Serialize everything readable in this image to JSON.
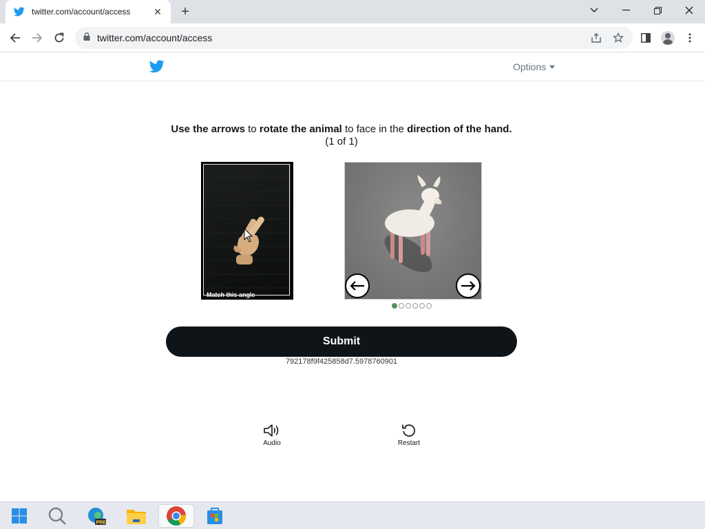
{
  "browser": {
    "tab": {
      "title": "twitter.com/account/access",
      "close": "✕"
    },
    "new_tab": "+",
    "url": "twitter.com/account/access"
  },
  "header": {
    "options_label": "Options"
  },
  "challenge": {
    "instruction_parts": [
      "Use the arrows",
      " to ",
      "rotate the animal",
      " to face in the ",
      "direction of the hand."
    ],
    "counter": "(1 of 1)",
    "reference_caption": "Match this angle",
    "dots_total": 6,
    "dot_active_index": 0,
    "submit_label": "Submit",
    "token": "792178f9f425858d7.5978760901"
  },
  "utilities": {
    "audio_label": "Audio",
    "restart_label": "Restart"
  },
  "colors": {
    "twitter_blue": "#1d9bf0",
    "submit_bg": "#0f1419",
    "active_dot": "#5a8f5a"
  }
}
